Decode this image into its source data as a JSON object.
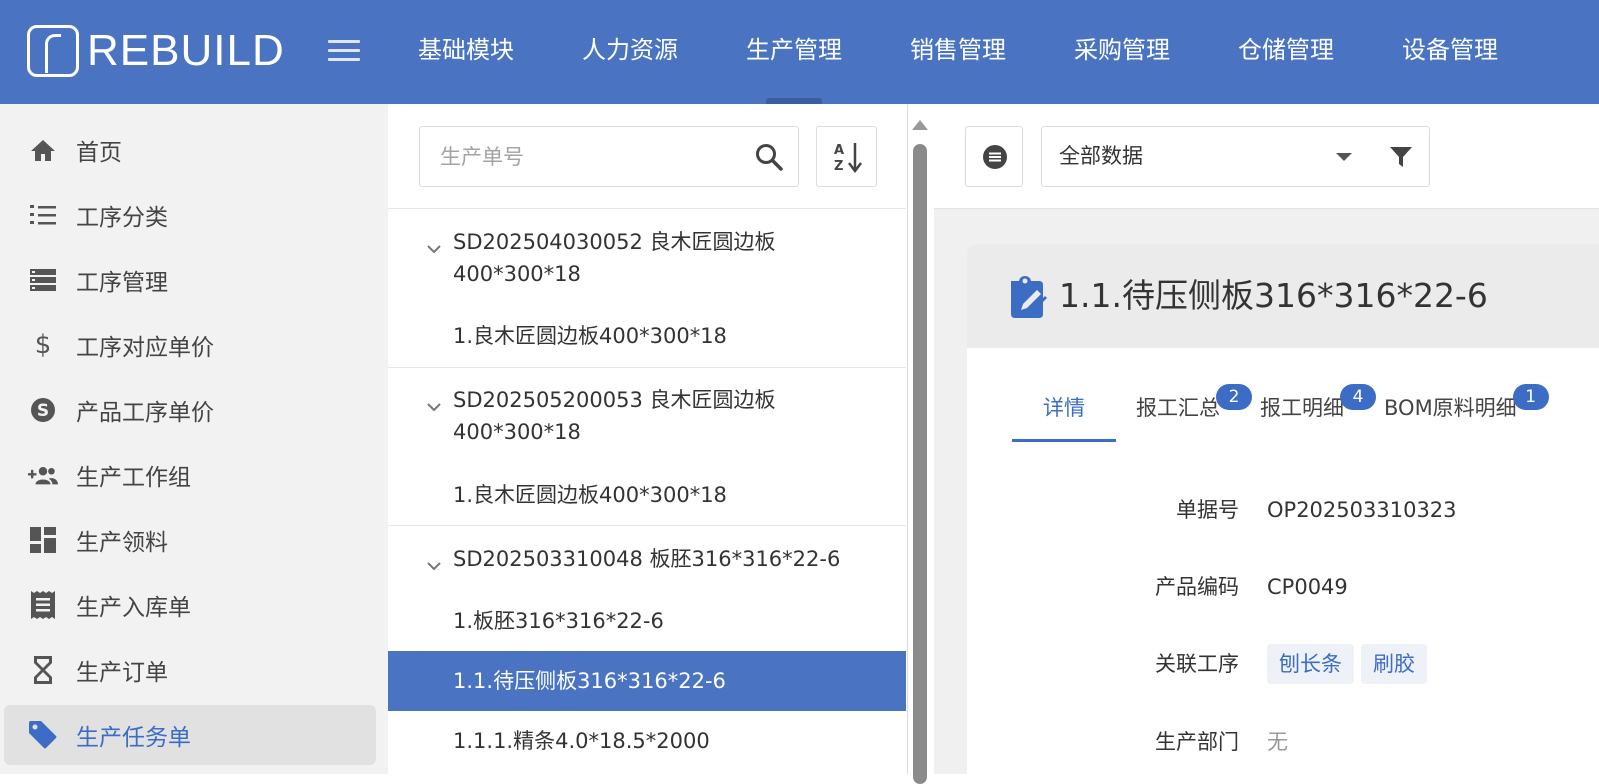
{
  "app": {
    "logo_text": "REBUILD"
  },
  "topnav": {
    "items": [
      {
        "label": "基础模块"
      },
      {
        "label": "人力资源"
      },
      {
        "label": "生产管理"
      },
      {
        "label": "销售管理"
      },
      {
        "label": "采购管理"
      },
      {
        "label": "仓储管理"
      },
      {
        "label": "设备管理"
      }
    ],
    "active_index": 2
  },
  "sidebar": {
    "items": [
      {
        "label": "首页",
        "icon": "home-icon"
      },
      {
        "label": "工序分类",
        "icon": "list-numbered-icon"
      },
      {
        "label": "工序管理",
        "icon": "storage-icon"
      },
      {
        "label": "工序对应单价",
        "icon": "dollar-icon"
      },
      {
        "label": "产品工序单价",
        "icon": "skype-icon"
      },
      {
        "label": "生产工作组",
        "icon": "group-add-icon"
      },
      {
        "label": "生产领料",
        "icon": "dashboard-icon"
      },
      {
        "label": "生产入库单",
        "icon": "receipt-icon"
      },
      {
        "label": "生产订单",
        "icon": "hourglass-icon"
      },
      {
        "label": "生产任务单",
        "icon": "tag-icon"
      }
    ],
    "active_index": 9
  },
  "list": {
    "search_placeholder": "生产单号",
    "groups": [
      {
        "title": "SD202504030052 良木匠圆边板400*300*18",
        "children": [
          "1.良木匠圆边板400*300*18"
        ]
      },
      {
        "title": "SD202505200053 良木匠圆边板400*300*18",
        "children": [
          "1.良木匠圆边板400*300*18"
        ]
      },
      {
        "title": "SD202503310048 板胚316*316*22-6",
        "children": [
          "1.板胚316*316*22-6",
          "1.1.待压侧板316*316*22-6",
          "1.1.1.精条4.0*18.5*2000"
        ]
      }
    ],
    "selected": "1.1.待压侧板316*316*22-6"
  },
  "detail": {
    "filter_label": "全部数据",
    "title": "1.1.待压侧板316*316*22-6",
    "tabs": [
      {
        "label": "详情",
        "badge": ""
      },
      {
        "label": "报工汇总",
        "badge": "2"
      },
      {
        "label": "报工明细",
        "badge": "4"
      },
      {
        "label": "BOM原料明细",
        "badge": "1"
      }
    ],
    "fields": {
      "doc_no": {
        "label": "单据号",
        "value": "OP202503310323"
      },
      "product_code": {
        "label": "产品编码",
        "value": "CP0049"
      },
      "process": {
        "label": "关联工序",
        "tags": [
          "刨长条",
          "刷胶"
        ]
      },
      "department": {
        "label": "生产部门",
        "value": "无"
      }
    }
  },
  "colors": {
    "brand": "#4a74c2",
    "accent": "#3c6cc4",
    "selected_row": "#4a74c2"
  }
}
